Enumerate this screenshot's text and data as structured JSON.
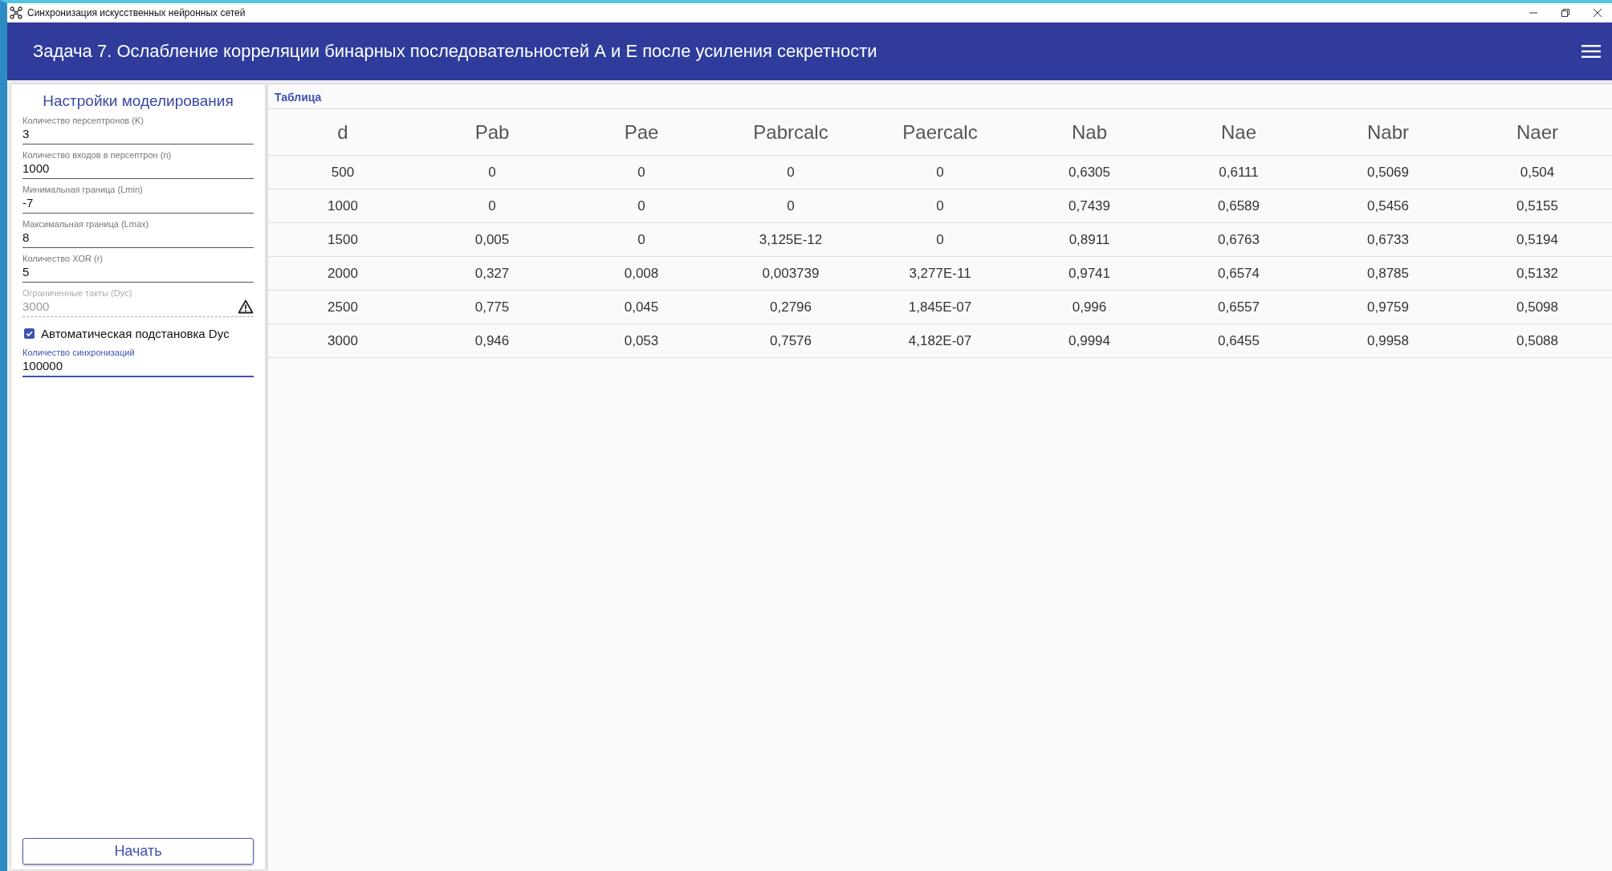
{
  "window": {
    "title": "Синхронизация искусственных нейронных сетей"
  },
  "header": {
    "title": "Задача 7. Ослабление корреляции бинарных последовательностей А и Е после усиления секретности"
  },
  "settings": {
    "title": "Настройки моделирования",
    "controls": [
      {
        "kind": "field",
        "label": "Количество персептронов (K)",
        "value": "3",
        "disabled": false,
        "focused": false,
        "warning": false
      },
      {
        "kind": "field",
        "label": "Количество входов в персептрон (n)",
        "value": "1000",
        "disabled": false,
        "focused": false,
        "warning": false
      },
      {
        "kind": "field",
        "label": "Минимальная граница (Lmin)",
        "value": "-7",
        "disabled": false,
        "focused": false,
        "warning": false
      },
      {
        "kind": "field",
        "label": "Максимальная граница (Lmax)",
        "value": "8",
        "disabled": false,
        "focused": false,
        "warning": false
      },
      {
        "kind": "field",
        "label": "Количество XOR (r)",
        "value": "5",
        "disabled": false,
        "focused": false,
        "warning": false
      },
      {
        "kind": "field",
        "label": "Ограниченные такты (Dyc)",
        "value": "3000",
        "disabled": true,
        "focused": false,
        "warning": true
      },
      {
        "kind": "checkbox",
        "label": "Автоматическая подстановка Dyc",
        "checked": true
      },
      {
        "kind": "field",
        "label": "Количество синхронизаций",
        "value": "100000",
        "disabled": false,
        "focused": true,
        "warning": false
      }
    ],
    "start_button": "Начать"
  },
  "table": {
    "title": "Таблица",
    "columns": [
      "d",
      "Pab",
      "Pae",
      "Pabrcalc",
      "Paercalc",
      "Nab",
      "Nae",
      "Nabr",
      "Naer"
    ],
    "rows": [
      [
        "500",
        "0",
        "0",
        "0",
        "0",
        "0,6305",
        "0,6111",
        "0,5069",
        "0,504"
      ],
      [
        "1000",
        "0",
        "0",
        "0",
        "0",
        "0,7439",
        "0,6589",
        "0,5456",
        "0,5155"
      ],
      [
        "1500",
        "0,005",
        "0",
        "3,125E-12",
        "0",
        "0,8911",
        "0,6763",
        "0,6733",
        "0,5194"
      ],
      [
        "2000",
        "0,327",
        "0,008",
        "0,003739",
        "3,277E-11",
        "0,9741",
        "0,6574",
        "0,8785",
        "0,5132"
      ],
      [
        "2500",
        "0,775",
        "0,045",
        "0,2796",
        "1,845E-07",
        "0,996",
        "0,6557",
        "0,9759",
        "0,5098"
      ],
      [
        "3000",
        "0,946",
        "0,053",
        "0,7576",
        "4,182E-07",
        "0,9994",
        "0,6455",
        "0,9958",
        "0,5088"
      ]
    ]
  }
}
